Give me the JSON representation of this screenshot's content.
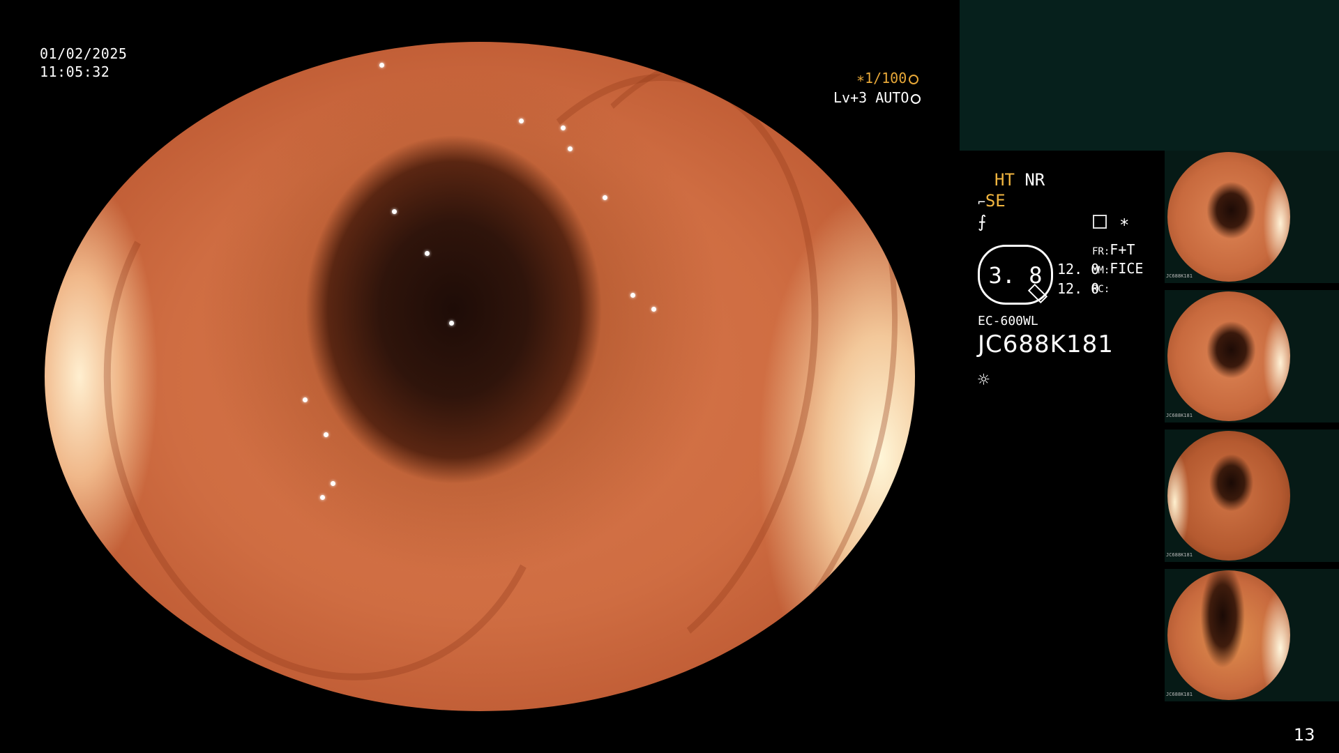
{
  "overlay": {
    "date": "01/02/2025",
    "time": "11:05:32",
    "shutter": "∗1/100",
    "level": "Lv+3 AUTO"
  },
  "panel": {
    "ht": "HT",
    "nr": "NR",
    "se": "SE",
    "fn_symbol": "⨍",
    "star": "∗",
    "gauge_value": "3. 8",
    "val1": "12. 0",
    "val2": "12. 0",
    "fr_label": "FR:",
    "fr_value": "F+T",
    "mm_label": "MM:",
    "mm_value": "FICE",
    "rc_label": "RC:",
    "model": "EC-600WL",
    "serial": "JC688K181",
    "light_symbol": "☼"
  },
  "thumbnails": [
    {
      "caption": "JC688K181"
    },
    {
      "caption": "JC688K181"
    },
    {
      "caption": "JC688K181"
    },
    {
      "caption": "JC688K181"
    }
  ],
  "page_number": "13"
}
